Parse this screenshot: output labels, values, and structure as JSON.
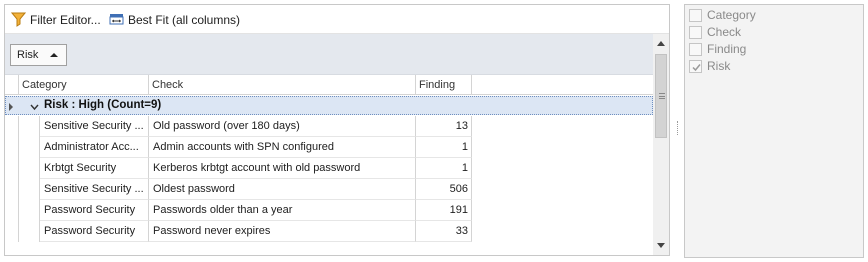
{
  "toolbar": {
    "filter_editor_label": "Filter Editor...",
    "best_fit_label": "Best Fit (all columns)"
  },
  "group_panel": {
    "chip_label": "Risk"
  },
  "columns": [
    {
      "label": "Category"
    },
    {
      "label": "Check"
    },
    {
      "label": "Finding"
    }
  ],
  "group_row": {
    "text": "Risk : High (Count=9)"
  },
  "rows": [
    {
      "category": "Sensitive Security ...",
      "check": "Old password (over 180 days)",
      "finding": "13"
    },
    {
      "category": "Administrator Acc...",
      "check": "Admin accounts with SPN configured",
      "finding": "1"
    },
    {
      "category": "Krbtgt Security",
      "check": "Kerberos krbtgt account with old password",
      "finding": "1"
    },
    {
      "category": "Sensitive Security ...",
      "check": "Oldest password",
      "finding": "506"
    },
    {
      "category": "Password Security",
      "check": "Passwords older than a year",
      "finding": "191"
    },
    {
      "category": "Password Security",
      "check": "Password never expires",
      "finding": "33"
    }
  ],
  "column_chooser": {
    "items": [
      {
        "label": "Category",
        "checked": false
      },
      {
        "label": "Check",
        "checked": false
      },
      {
        "label": "Finding",
        "checked": false
      },
      {
        "label": "Risk",
        "checked": true
      }
    ]
  },
  "colors": {
    "group_row_bg": "#dce6f4",
    "group_area_bg": "#e4e8ee",
    "side_panel_bg": "#f3f3f3"
  }
}
